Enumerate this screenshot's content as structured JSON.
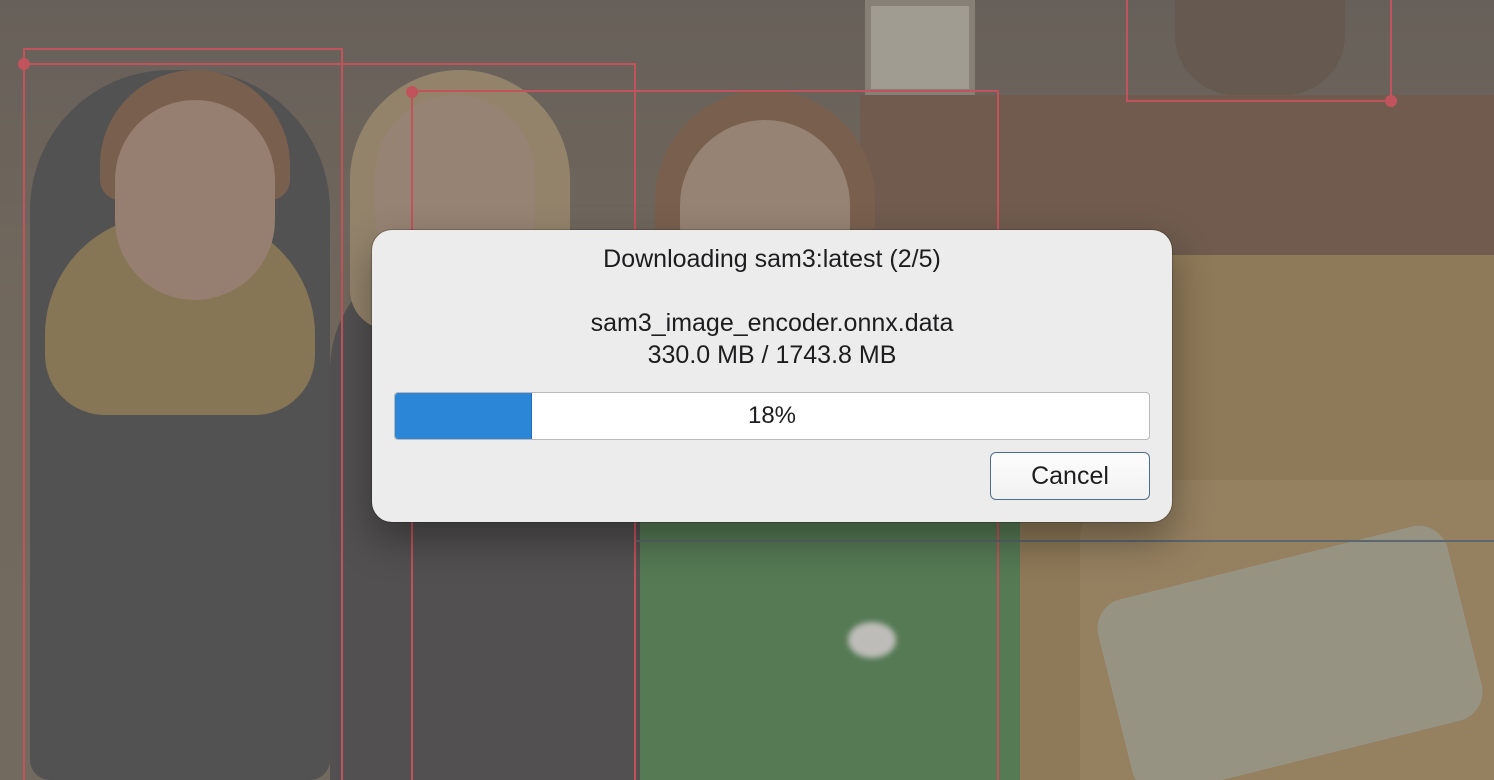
{
  "dialog": {
    "title": "Downloading sam3:latest (2/5)",
    "file_name": "sam3_image_encoder.onnx.data",
    "file_progress": "330.0 MB / 1743.8 MB",
    "progress": {
      "percent": 18,
      "label": "18%",
      "fill_color": "#2b86d8"
    },
    "cancel_label": "Cancel"
  },
  "annotations": {
    "box_color": "#c0535b"
  }
}
